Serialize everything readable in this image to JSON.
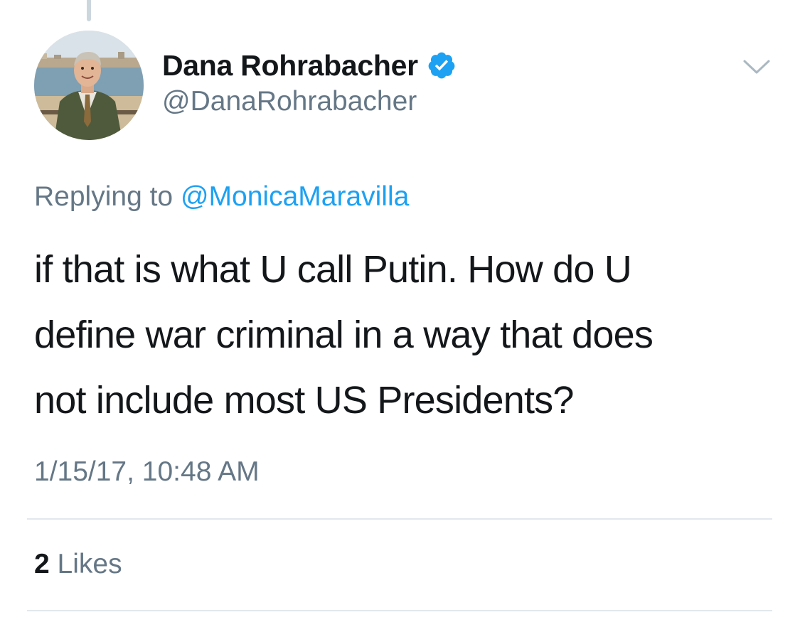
{
  "tweet": {
    "author": {
      "display_name": "Dana Rohrabacher",
      "handle": "@DanaRohrabacher",
      "verified": true,
      "verified_icon": "verified-badge-icon",
      "avatar": "profile-photo"
    },
    "menu_icon": "chevron-down-icon",
    "reply": {
      "prefix": "Replying to",
      "mention": "@MonicaMaravilla"
    },
    "text_lines": [
      "if that is what U call Putin. How do U",
      "define war criminal in a way that does",
      "not include most US Presidents?"
    ],
    "timestamp": "1/15/17, 10:48 AM",
    "likes": {
      "count": "2",
      "label": "Likes"
    }
  },
  "colors": {
    "primary_text": "#14171a",
    "secondary_text": "#657786",
    "accent": "#1da1f2",
    "divider": "#e1e8ed"
  }
}
